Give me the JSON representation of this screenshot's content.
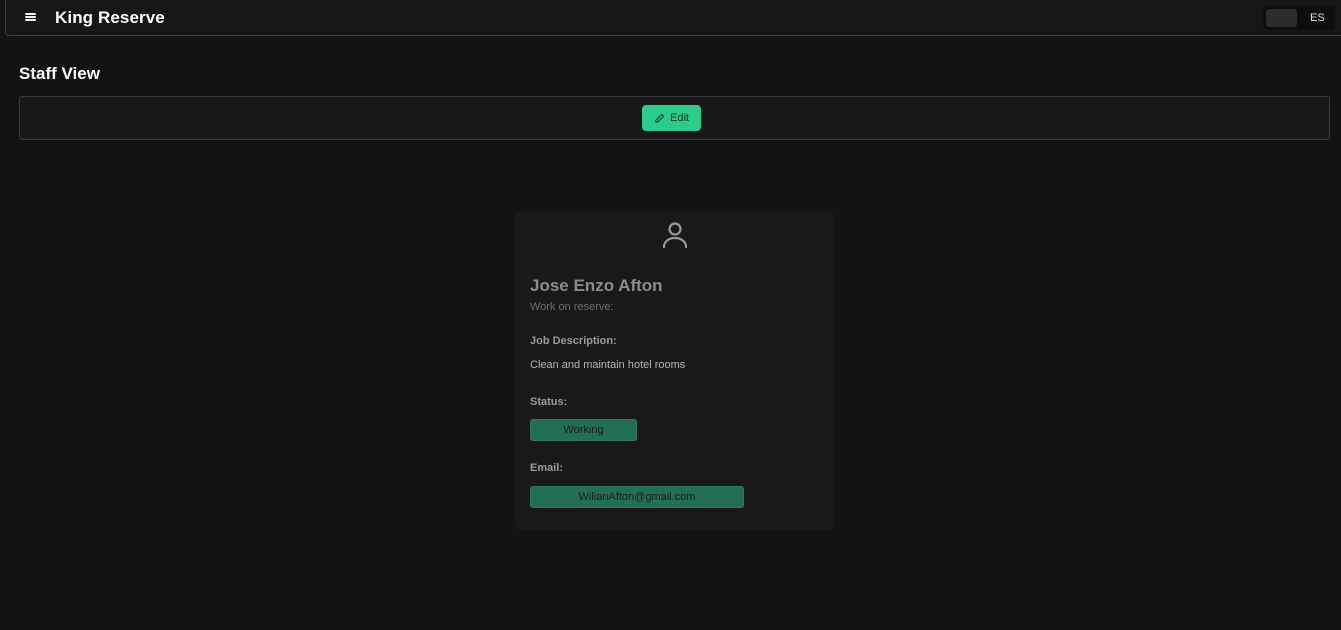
{
  "app": {
    "title": "King Reserve"
  },
  "header": {
    "menu_icon": "hamburger-menu-icon",
    "language_label": "ES"
  },
  "page": {
    "title": "Staff View"
  },
  "toolbar": {
    "edit_label": "Edit",
    "edit_icon": "pencil-icon"
  },
  "colors": {
    "accent": "#2bcb8b",
    "pill_bg": "#227051",
    "background": "#131313",
    "card_bg": "#19191b"
  },
  "staff": {
    "avatar_icon": "user-icon",
    "name": "Jose Enzo Afton",
    "subtitle": "Work on reserve:",
    "job_label": "Job Description:",
    "job_value": "Clean and maintain hotel rooms",
    "status_label": "Status:",
    "status_value": "Working",
    "email_label": "Email:",
    "email_value": "WilianAfton@gmail.com"
  }
}
